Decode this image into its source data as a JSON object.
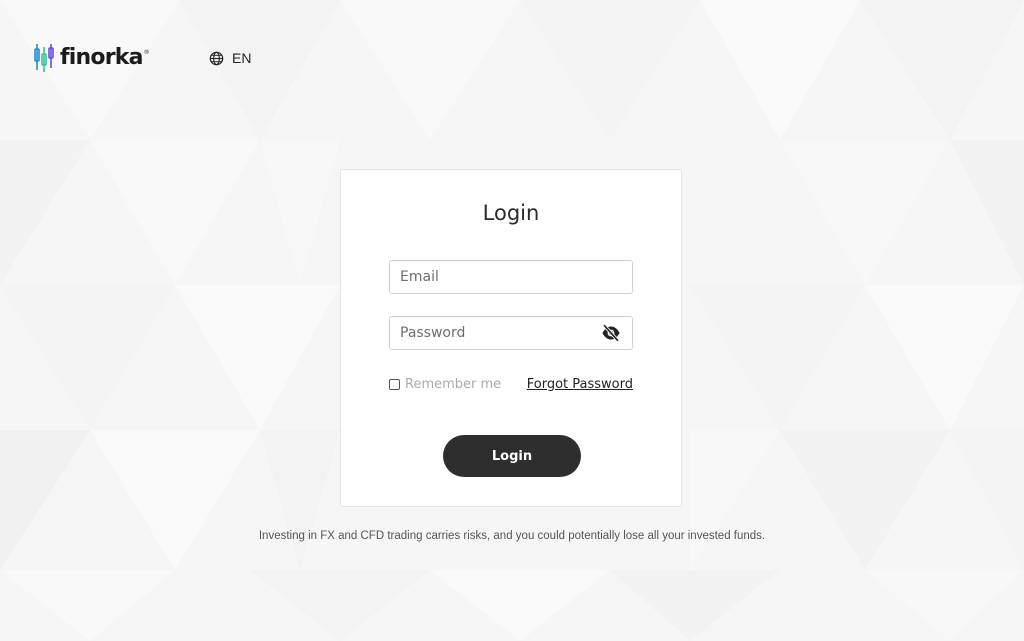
{
  "brand": {
    "name": "finorka",
    "mark": "®",
    "logo_colors": [
      "#1c8fd6",
      "#3fbf9a",
      "#6c4bd6"
    ]
  },
  "language": {
    "label": "EN",
    "icon": "globe-icon"
  },
  "login_form": {
    "title": "Login",
    "email_placeholder": "Email",
    "password_placeholder": "Password",
    "toggle_password_icon": "eye-off-icon",
    "remember_label": "Remember me",
    "remember_checked": false,
    "forgot_label": "Forgot Password",
    "submit_label": "Login"
  },
  "disclaimer": "Investing in FX and CFD trading carries risks, and you could potentially lose all your invested funds.",
  "colors": {
    "button_bg": "#2e2e2e",
    "page_bg": "#f7f7f7",
    "card_bg": "#ffffff"
  }
}
